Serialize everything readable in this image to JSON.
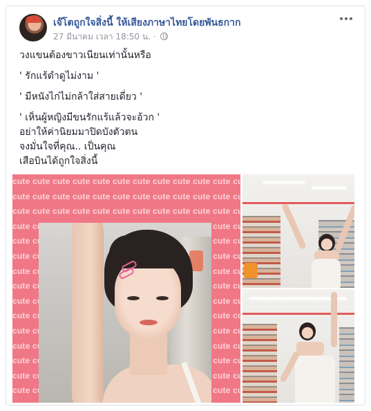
{
  "post": {
    "page_name": "เจ๊โตถูกใจสิ่งนี้ ให้เสียงภาษาไทยโดยพันธกาก",
    "timestamp": "27 มีนาคม เวลา 18:50 น. ·",
    "privacy_icon": "globe-icon",
    "more_icon": "more-options-icon",
    "text_lines": [
      "วงแขนต้องขาวเนียนเท่านั้นหรือ",
      "' รักแร้ดำดูไม่งาม '",
      "' มีหนังไก่ไม่กล้าใส่สายเดี่ยว '",
      "' เห็นผู้หญิงมีขนรักแร้แล้วจะอ้วก '",
      "อย่าให้ค่านิยมมาปิดบังตัวตน",
      "จงมั่นใจที่คุณ.. เป็นคุณ",
      "เสือบินได้ถูกใจสิ่งนี้"
    ],
    "photo_overlay_word": "cute"
  },
  "colors": {
    "link": "#365899",
    "meta": "#90949c",
    "pink_frame": "#f07886",
    "cute_text": "#ffd2d8"
  }
}
